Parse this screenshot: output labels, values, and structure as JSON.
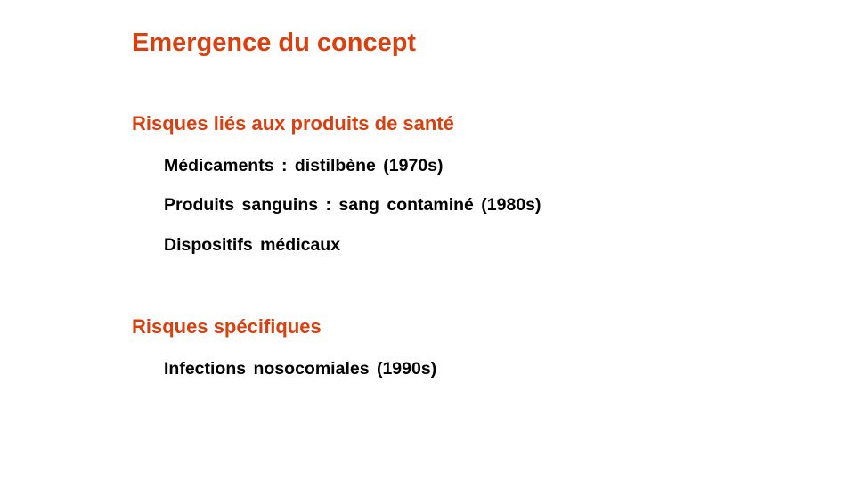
{
  "colors": {
    "accent": "#d9400f",
    "text": "#000000",
    "background": "#ffffff"
  },
  "slide": {
    "title": "Emergence du concept",
    "sections": [
      {
        "heading": "Risques liés aux produits de santé",
        "items": [
          "Médicaments  : distilbène  (1970s)",
          "Produits  sanguins  : sang  contaminé  (1980s)",
          "Dispositifs  médicaux"
        ]
      },
      {
        "heading": "Risques spécifiques",
        "items": [
          "Infections  nosocomiales  (1990s)"
        ]
      }
    ]
  }
}
